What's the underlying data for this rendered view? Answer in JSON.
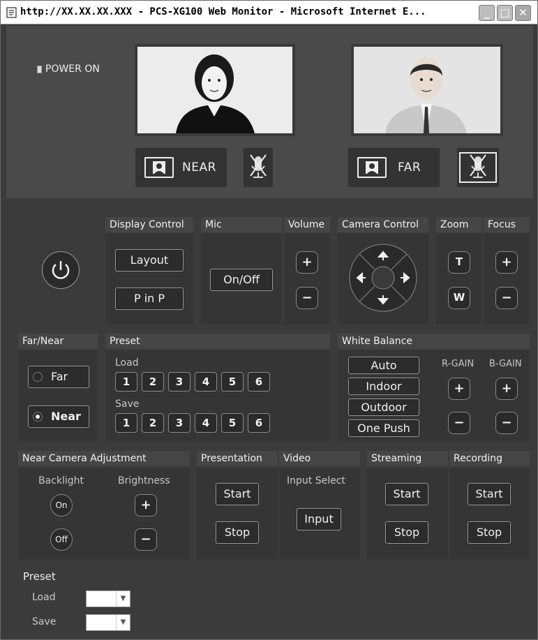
{
  "window": {
    "title": "http://XX.XX.XX.XXX - PCS-XG100 Web Monitor - Microsoft Internet E..."
  },
  "status": {
    "power": "POWER ON"
  },
  "cameras": {
    "near_label": "NEAR",
    "far_label": "FAR"
  },
  "display_control": {
    "title": "Display Control",
    "layout": "Layout",
    "pinp": "P in P"
  },
  "mic": {
    "title": "Mic",
    "onoff": "On/Off"
  },
  "volume": {
    "title": "Volume",
    "plus": "+",
    "minus": "−"
  },
  "camera_control": {
    "title": "Camera Control"
  },
  "zoom": {
    "title": "Zoom",
    "tele": "T",
    "wide": "W"
  },
  "focus": {
    "title": "Focus",
    "plus": "+",
    "minus": "−"
  },
  "far_near": {
    "title": "Far/Near",
    "far": "Far",
    "near": "Near",
    "selected": "Near"
  },
  "preset": {
    "title": "Preset",
    "load": "Load",
    "save": "Save",
    "numbers": [
      "1",
      "2",
      "3",
      "4",
      "5",
      "6"
    ]
  },
  "white_balance": {
    "title": "White Balance",
    "auto": "Auto",
    "indoor": "Indoor",
    "outdoor": "Outdoor",
    "one_push": "One Push",
    "r_gain": "R-GAIN",
    "b_gain": "B-GAIN",
    "plus": "+",
    "minus": "−"
  },
  "near_camera_adjustment": {
    "title": "Near Camera Adjustment",
    "backlight": "Backlight",
    "brightness": "Brightness",
    "on": "On",
    "off": "Off",
    "plus": "+",
    "minus": "−"
  },
  "presentation": {
    "title": "Presentation",
    "start": "Start",
    "stop": "Stop"
  },
  "video": {
    "title": "Video",
    "input_select": "Input Select",
    "input": "Input"
  },
  "streaming": {
    "title": "Streaming",
    "start": "Start",
    "stop": "Stop"
  },
  "recording": {
    "title": "Recording",
    "start": "Start",
    "stop": "Stop"
  },
  "bottom_preset": {
    "title": "Preset",
    "load": "Load",
    "save": "Save",
    "load_value": "",
    "save_value": ""
  }
}
